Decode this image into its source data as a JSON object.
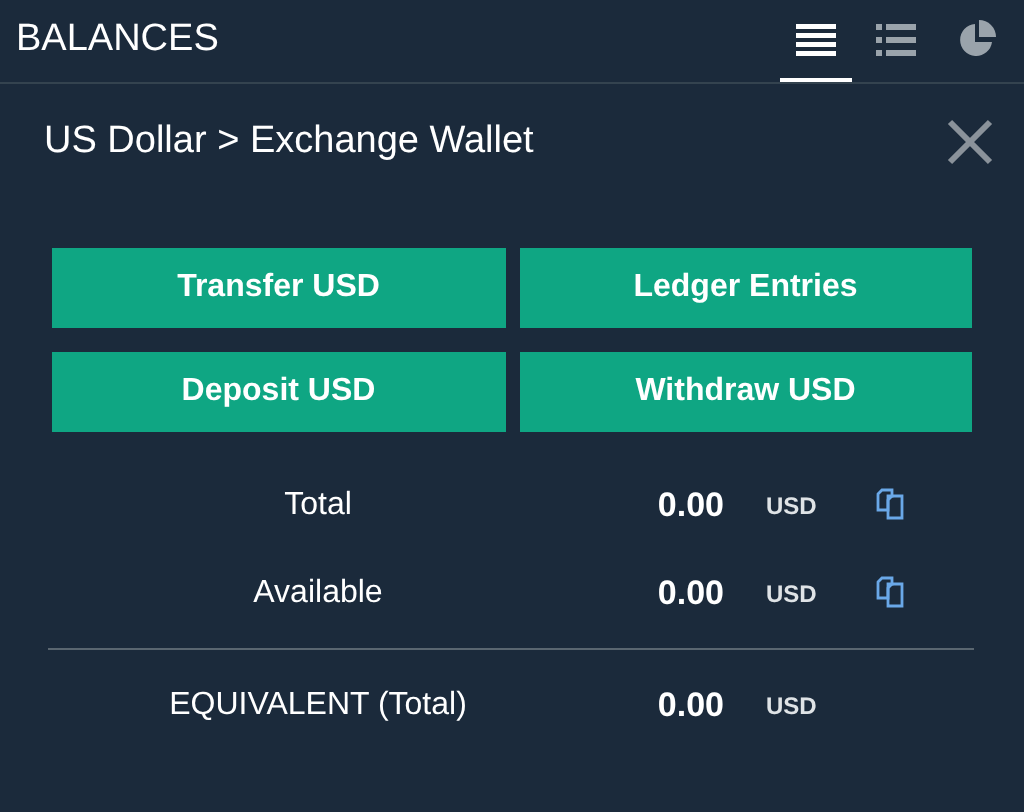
{
  "header": {
    "title": "BALANCES"
  },
  "view_tabs": [
    {
      "kind": "table",
      "selected": true
    },
    {
      "kind": "list",
      "selected": false
    },
    {
      "kind": "pie",
      "selected": false
    }
  ],
  "breadcrumb": "US Dollar > Exchange Wallet",
  "buttons": [
    "Transfer USD",
    "Ledger Entries",
    "Deposit USD",
    "Withdraw USD"
  ],
  "rows": [
    {
      "label": "Total",
      "value": "0.00",
      "currency": "USD",
      "copyable": true
    },
    {
      "label": "Available",
      "value": "0.00",
      "currency": "USD",
      "copyable": true
    },
    {
      "label": "EQUIVALENT (Total)",
      "value": "0.00",
      "currency": "USD",
      "copyable": false
    }
  ]
}
